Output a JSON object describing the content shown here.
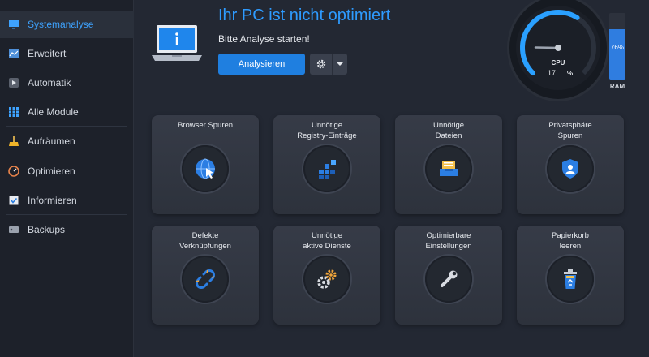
{
  "sidebar": {
    "items": [
      {
        "label": "Systemanalyse",
        "icon": "monitor-icon",
        "active": true
      },
      {
        "label": "Erweitert",
        "icon": "chart-icon"
      },
      {
        "label": "Automatik",
        "icon": "play-icon"
      },
      {
        "label": "Alle Module",
        "icon": "grid-icon"
      },
      {
        "label": "Aufräumen",
        "icon": "broom-icon"
      },
      {
        "label": "Optimieren",
        "icon": "speedometer-icon"
      },
      {
        "label": "Informieren",
        "icon": "checklist-icon"
      },
      {
        "label": "Backups",
        "icon": "drive-icon"
      }
    ]
  },
  "header": {
    "title": "Ihr PC ist nicht optimiert",
    "subtitle": "Bitte Analyse starten!",
    "analyze_label": "Analysieren"
  },
  "gauge": {
    "cpu_label": "CPU",
    "cpu_value": "17",
    "cpu_unit": "%",
    "cpu_fraction": 0.17,
    "ram_label": "RAM",
    "ram_value": "76%",
    "ram_fraction": 0.76
  },
  "modules": [
    {
      "label": "Browser Spuren",
      "icon": "globe-cursor-icon"
    },
    {
      "label": "Unnötige\nRegistry-Einträge",
      "icon": "registry-blocks-icon"
    },
    {
      "label": "Unnötige\nDateien",
      "icon": "files-tray-icon"
    },
    {
      "label": "Privatsphäre\nSpuren",
      "icon": "shield-user-icon"
    },
    {
      "label": "Defekte\nVerknüpfungen",
      "icon": "broken-link-icon"
    },
    {
      "label": "Unnötige\naktive Dienste",
      "icon": "gears-icon"
    },
    {
      "label": "Optimierbare\nEinstellungen",
      "icon": "wrench-icon"
    },
    {
      "label": "Papierkorb\nleeren",
      "icon": "recycle-bin-icon"
    }
  ],
  "colors": {
    "accent": "#2e9bff",
    "button": "#1f7fe0",
    "background": "#232833",
    "sidebar": "#1d212a"
  }
}
